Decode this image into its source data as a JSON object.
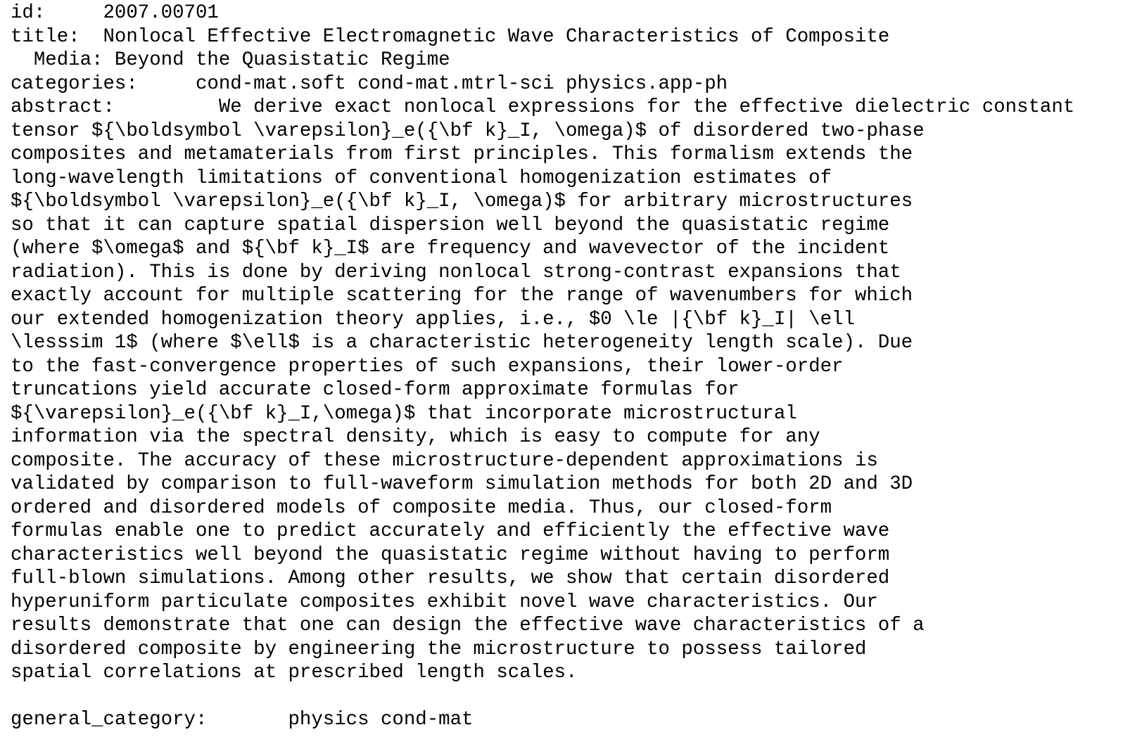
{
  "record": {
    "id": {
      "label": "id:",
      "gap": "     ",
      "value": "2007.00701"
    },
    "title": {
      "label": "title:",
      "gap": "  ",
      "line1": "Nonlocal Effective Electromagnetic Wave Characteristics of Composite",
      "line2": "  Media: Beyond the Quasistatic Regime"
    },
    "categories": {
      "label": "categories:",
      "gap": "     ",
      "value": "cond-mat.soft cond-mat.mtrl-sci physics.app-ph"
    },
    "abstract": {
      "label": "abstract:",
      "gap": "         ",
      "first_line": "We derive exact nonlocal expressions for the effective dielectric constant",
      "lines": [
        "tensor ${\\boldsymbol \\varepsilon}_e({\\bf k}_I, \\omega)$ of disordered two-phase",
        "composites and metamaterials from first principles. This formalism extends the",
        "long-wavelength limitations of conventional homogenization estimates of",
        "${\\boldsymbol \\varepsilon}_e({\\bf k}_I, \\omega)$ for arbitrary microstructures",
        "so that it can capture spatial dispersion well beyond the quasistatic regime",
        "(where $\\omega$ and ${\\bf k}_I$ are frequency and wavevector of the incident",
        "radiation). This is done by deriving nonlocal strong-contrast expansions that",
        "exactly account for multiple scattering for the range of wavenumbers for which",
        "our extended homogenization theory applies, i.e., $0 \\le |{\\bf k}_I| \\ell",
        "\\lesssim 1$ (where $\\ell$ is a characteristic heterogeneity length scale). Due",
        "to the fast-convergence properties of such expansions, their lower-order",
        "truncations yield accurate closed-form approximate formulas for",
        "${\\varepsilon}_e({\\bf k}_I,\\omega)$ that incorporate microstructural",
        "information via the spectral density, which is easy to compute for any",
        "composite. The accuracy of these microstructure-dependent approximations is",
        "validated by comparison to full-waveform simulation methods for both 2D and 3D",
        "ordered and disordered models of composite media. Thus, our closed-form",
        "formulas enable one to predict accurately and efficiently the effective wave",
        "characteristics well beyond the quasistatic regime without having to perform",
        "full-blown simulations. Among other results, we show that certain disordered",
        "hyperuniform particulate composites exhibit novel wave characteristics. Our",
        "results demonstrate that one can design the effective wave characteristics of a",
        "disordered composite by engineering the microstructure to possess tailored",
        "spatial correlations at prescribed length scales."
      ]
    },
    "general_category": {
      "label": "general_category:",
      "gap": "       ",
      "value": "physics cond-mat"
    }
  }
}
